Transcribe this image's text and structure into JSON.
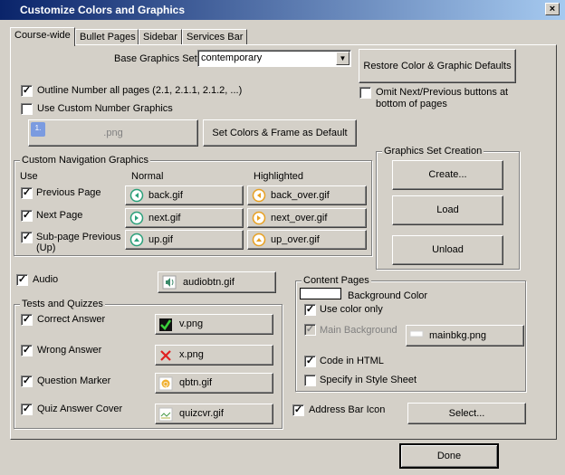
{
  "window": {
    "title": "Customize Colors and Graphics",
    "close_symbol": "×"
  },
  "tabs": [
    {
      "label": "Course-wide",
      "active": true
    },
    {
      "label": "Bullet Pages"
    },
    {
      "label": "Sidebar"
    },
    {
      "label": "Services Bar"
    }
  ],
  "base_graphics": {
    "label": "Base Graphics Set",
    "value": "contemporary"
  },
  "restore_button": "Restore Color & Graphic Defaults",
  "outline_number": {
    "label": "Outline Number all pages (2.1, 2.1.1, 2.1.2, ...)",
    "checked": true
  },
  "custom_number": {
    "label": "Use Custom Number Graphics",
    "checked": false
  },
  "number_graphic_button": {
    "label": ".png",
    "badge": "1."
  },
  "omit_nav": {
    "label_line1": "Omit Next/Previous buttons at",
    "label_line2": "bottom of pages",
    "checked": false
  },
  "set_colors_button": "Set Colors & Frame as Default",
  "nav_graphics": {
    "title": "Custom Navigation Graphics",
    "col_use": "Use",
    "col_normal": "Normal",
    "col_highlighted": "Highlighted",
    "rows": [
      {
        "label": "Previous Page",
        "checked": true,
        "normal": "back.gif",
        "highlighted": "back_over.gif"
      },
      {
        "label": "Next Page",
        "checked": true,
        "normal": "next.gif",
        "highlighted": "next_over.gif"
      },
      {
        "label_line1": "Sub-page Previous",
        "label_line2": "(Up)",
        "checked": true,
        "normal": "up.gif",
        "highlighted": "up_over.gif"
      }
    ]
  },
  "graphics_set": {
    "title": "Graphics Set Creation",
    "create": "Create...",
    "load": "Load",
    "unload": "Unload"
  },
  "audio": {
    "label": "Audio",
    "checked": true,
    "file": "audiobtn.gif"
  },
  "tests": {
    "title": "Tests and Quizzes",
    "rows": [
      {
        "label": "Correct Answer",
        "checked": true,
        "file": "v.png"
      },
      {
        "label": "Wrong Answer",
        "checked": true,
        "file": "x.png"
      },
      {
        "label": "Question Marker",
        "checked": true,
        "file": "qbtn.gif"
      },
      {
        "label": "Quiz Answer Cover",
        "checked": true,
        "file": "quizcvr.gif"
      }
    ]
  },
  "content_pages": {
    "title": "Content Pages",
    "background_color": "Background Color",
    "use_color_only": "Use color only",
    "main_background": "Main Background",
    "main_bkg_file": "mainbkg.png",
    "code_html": "Code in HTML",
    "style_sheet": "Specify in Style Sheet"
  },
  "address_bar": {
    "label": "Address Bar Icon",
    "checked": true,
    "button": "Select..."
  },
  "done_button": "Done",
  "colors": {
    "title_start": "#0a246a",
    "title_end": "#a6caf0",
    "face": "#d4d0c8"
  }
}
